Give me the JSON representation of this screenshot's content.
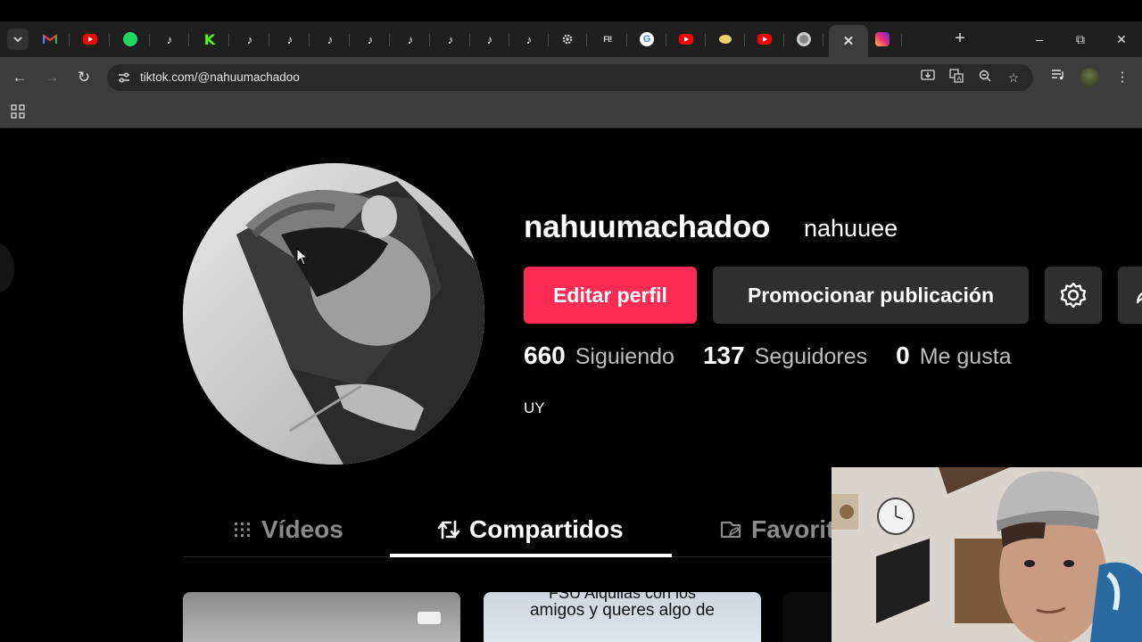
{
  "browser": {
    "tabs": [
      {
        "icon": "gmail-icon"
      },
      {
        "icon": "youtube-icon"
      },
      {
        "icon": "spotify-icon"
      },
      {
        "icon": "tiktok-icon"
      },
      {
        "icon": "kick-icon",
        "glyph": "K"
      },
      {
        "icon": "tiktok-icon"
      },
      {
        "icon": "tiktok-icon"
      },
      {
        "icon": "tiktok-icon"
      },
      {
        "icon": "tiktok-icon"
      },
      {
        "icon": "tiktok-icon"
      },
      {
        "icon": "tiktok-icon"
      },
      {
        "icon": "tiktok-icon"
      },
      {
        "icon": "tiktok-icon"
      },
      {
        "icon": "settings-icon"
      },
      {
        "icon": "fi-icon",
        "glyph": "FI!"
      },
      {
        "icon": "google-icon",
        "glyph": "G"
      },
      {
        "icon": "youtube-icon"
      },
      {
        "icon": "egg-icon"
      },
      {
        "icon": "youtube-icon"
      },
      {
        "icon": "chrome-icon"
      },
      {
        "icon": "close-icon",
        "active": true
      },
      {
        "icon": "instagram-icon"
      }
    ],
    "url": "tiktok.com/@nahuumachadoo"
  },
  "profile": {
    "username": "nahuumachadoo",
    "nickname": "nahuuee",
    "edit_button": "Editar perfil",
    "promote_button": "Promocionar publicación",
    "stats": {
      "following_count": "660",
      "following_label": "Siguiendo",
      "followers_count": "137",
      "followers_label": "Seguidores",
      "likes_count": "0",
      "likes_label": "Me gusta"
    },
    "bio": "UY",
    "tabs": {
      "videos": "Vídeos",
      "shared": "Compartidos",
      "favorites": "Favorit",
      "active": "shared"
    },
    "cards": {
      "card2_caption_top": "FSU Alquilas con los",
      "card2_caption": "amigos y queres algo de"
    }
  },
  "colors": {
    "tiktok_red": "#fe2c55",
    "button_gray": "#2f2f2f",
    "chrome_dark": "#3c3c3c",
    "tab_strip": "#1f1f1f"
  }
}
